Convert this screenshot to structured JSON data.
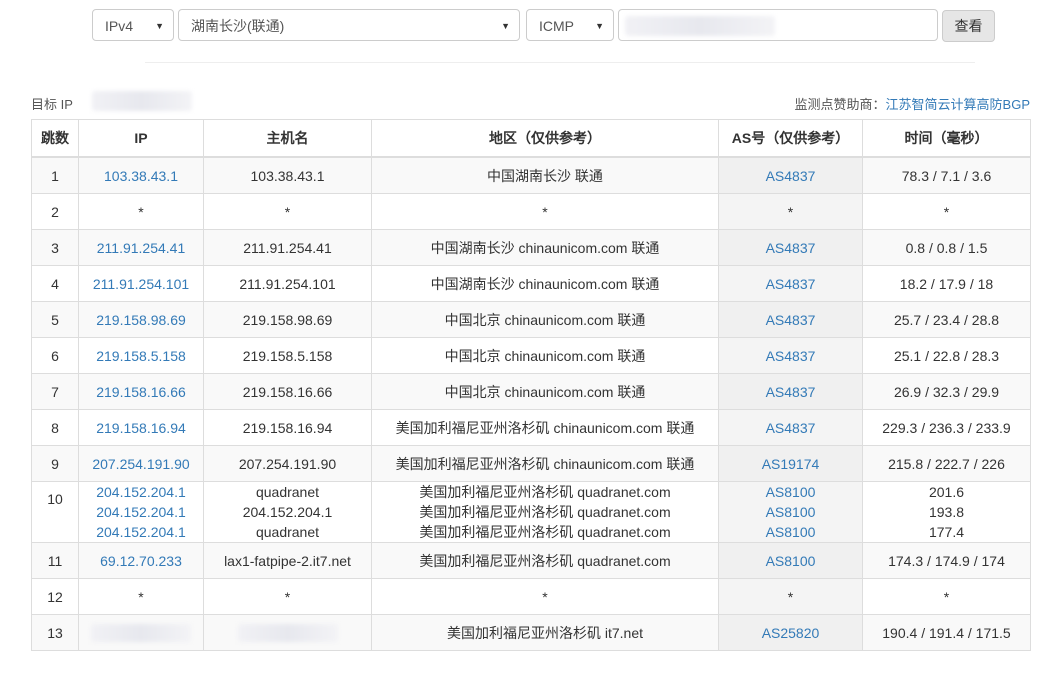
{
  "toolbar": {
    "protocol": "IPv4",
    "location": "湖南长沙(联通)",
    "method": "ICMP",
    "query_button": "查看"
  },
  "target": {
    "label": "目标 IP"
  },
  "sponsor": {
    "prefix": "监测点赞助商：",
    "name": "江苏智简云计算高防BGP"
  },
  "table": {
    "headers": [
      "跳数",
      "IP",
      "主机名",
      "地区（仅供参考）",
      "AS号（仅供参考）",
      "时间（毫秒）"
    ],
    "rows": [
      {
        "hop": "1",
        "ip": [
          "103.38.43.1"
        ],
        "host": [
          "103.38.43.1"
        ],
        "region": [
          "中国湖南长沙 联通"
        ],
        "asn": [
          "AS4837"
        ],
        "time": [
          "78.3 / 7.1 / 3.6"
        ]
      },
      {
        "hop": "2",
        "ip": [
          "*"
        ],
        "host": [
          "*"
        ],
        "region": [
          "*"
        ],
        "asn": [
          "*"
        ],
        "time": [
          "*"
        ]
      },
      {
        "hop": "3",
        "ip": [
          "211.91.254.41"
        ],
        "host": [
          "211.91.254.41"
        ],
        "region": [
          "中国湖南长沙 chinaunicom.com 联通"
        ],
        "asn": [
          "AS4837"
        ],
        "time": [
          "0.8 / 0.8 / 1.5"
        ]
      },
      {
        "hop": "4",
        "ip": [
          "211.91.254.101"
        ],
        "host": [
          "211.91.254.101"
        ],
        "region": [
          "中国湖南长沙 chinaunicom.com 联通"
        ],
        "asn": [
          "AS4837"
        ],
        "time": [
          "18.2 / 17.9 / 18"
        ]
      },
      {
        "hop": "5",
        "ip": [
          "219.158.98.69"
        ],
        "host": [
          "219.158.98.69"
        ],
        "region": [
          "中国北京 chinaunicom.com 联通"
        ],
        "asn": [
          "AS4837"
        ],
        "time": [
          "25.7 / 23.4 / 28.8"
        ]
      },
      {
        "hop": "6",
        "ip": [
          "219.158.5.158"
        ],
        "host": [
          "219.158.5.158"
        ],
        "region": [
          "中国北京 chinaunicom.com 联通"
        ],
        "asn": [
          "AS4837"
        ],
        "time": [
          "25.1 / 22.8 / 28.3"
        ]
      },
      {
        "hop": "7",
        "ip": [
          "219.158.16.66"
        ],
        "host": [
          "219.158.16.66"
        ],
        "region": [
          "中国北京 chinaunicom.com 联通"
        ],
        "asn": [
          "AS4837"
        ],
        "time": [
          "26.9 / 32.3 / 29.9"
        ]
      },
      {
        "hop": "8",
        "ip": [
          "219.158.16.94"
        ],
        "host": [
          "219.158.16.94"
        ],
        "region": [
          "美国加利福尼亚州洛杉矶 chinaunicom.com 联通"
        ],
        "asn": [
          "AS4837"
        ],
        "time": [
          "229.3 / 236.3 / 233.9"
        ]
      },
      {
        "hop": "9",
        "ip": [
          "207.254.191.90"
        ],
        "host": [
          "207.254.191.90"
        ],
        "region": [
          "美国加利福尼亚州洛杉矶 chinaunicom.com 联通"
        ],
        "asn": [
          "AS19174"
        ],
        "time": [
          "215.8 / 222.7 / 226"
        ]
      },
      {
        "hop": "10",
        "ip": [
          "204.152.204.1",
          "204.152.204.1",
          "204.152.204.1"
        ],
        "host": [
          "quadranet",
          "204.152.204.1",
          "quadranet"
        ],
        "region": [
          "美国加利福尼亚州洛杉矶 quadranet.com",
          "美国加利福尼亚州洛杉矶 quadranet.com",
          "美国加利福尼亚州洛杉矶 quadranet.com"
        ],
        "asn": [
          "AS8100",
          "AS8100",
          "AS8100"
        ],
        "time": [
          "201.6",
          "193.8",
          "177.4"
        ]
      },
      {
        "hop": "11",
        "ip": [
          "69.12.70.233"
        ],
        "host": [
          "lax1-fatpipe-2.it7.net"
        ],
        "region": [
          "美国加利福尼亚州洛杉矶 quadranet.com"
        ],
        "asn": [
          "AS8100"
        ],
        "time": [
          "174.3 / 174.9 / 174"
        ]
      },
      {
        "hop": "12",
        "ip": [
          "*"
        ],
        "host": [
          "*"
        ],
        "region": [
          "*"
        ],
        "asn": [
          "*"
        ],
        "time": [
          "*"
        ]
      },
      {
        "hop": "13",
        "ip": [],
        "host": [],
        "region": [
          "美国加利福尼亚州洛杉矶 it7.net"
        ],
        "asn": [
          "AS25820"
        ],
        "time": [
          "190.4 / 191.4 / 171.5"
        ]
      }
    ]
  }
}
